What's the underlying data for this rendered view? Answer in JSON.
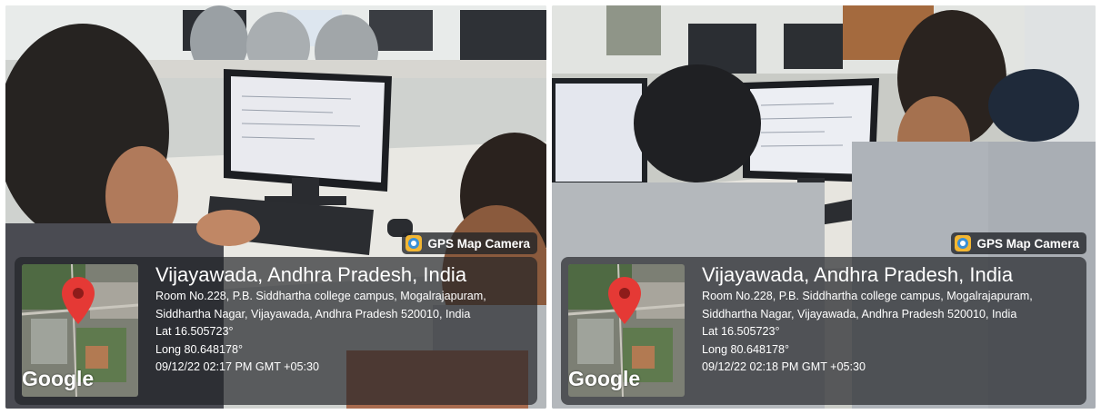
{
  "photos": [
    {
      "id_label": "left",
      "brand_label": "GPS Map Camera",
      "city": "Vijayawada, Andhra Pradesh, India",
      "address_line1": "Room No.228, P.B. Siddhartha college campus, Mogalrajapuram,",
      "address_line2": "Siddhartha Nagar, Vijayawada, Andhra Pradesh 520010, India",
      "lat": "Lat 16.505723°",
      "long": "Long 80.648178°",
      "datetime": "09/12/22 02:17 PM GMT +05:30",
      "map_brand": "Google"
    },
    {
      "id_label": "right",
      "brand_label": "GPS Map Camera",
      "city": "Vijayawada, Andhra Pradesh, India",
      "address_line1": "Room No.228, P.B. Siddhartha college campus, Mogalrajapuram,",
      "address_line2": "Siddhartha Nagar, Vijayawada, Andhra Pradesh 520010, India",
      "lat": "Lat 16.505723°",
      "long": "Long 80.648178°",
      "datetime": "09/12/22 02:18 PM GMT +05:30",
      "map_brand": "Google"
    }
  ],
  "colors": {
    "overlay": "#202226",
    "map_pin": "#e53935",
    "app_icon": "#f2b632"
  },
  "icons": [
    "map-pin-icon",
    "gps-map-camera-app-icon"
  ]
}
